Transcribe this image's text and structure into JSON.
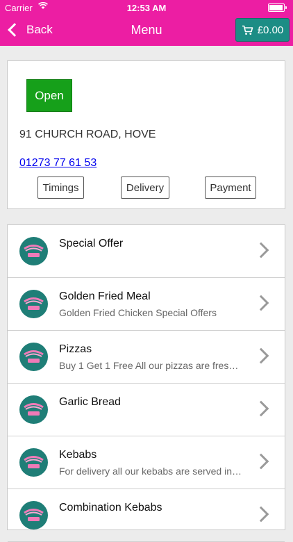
{
  "status_bar": {
    "carrier": "Carrier",
    "time": "12:53 AM"
  },
  "nav": {
    "back_label": "Back",
    "title": "Menu",
    "cart_total": "£0.00"
  },
  "colors": {
    "nav_background": "#ec1ea3",
    "cart_button": "#1c8d85",
    "open_button": "#16a01a",
    "logo_background": "#1f7e77"
  },
  "store": {
    "status": "Open",
    "address": "91 CHURCH ROAD, HOVE",
    "phone": "01273 77 61 53",
    "buttons": {
      "timings": "Timings",
      "delivery": "Delivery",
      "payment": "Payment"
    }
  },
  "menu": {
    "items": [
      {
        "name": "Special Offer",
        "description": ""
      },
      {
        "name": "Golden Fried Meal",
        "description": "Golden Fried Chicken Special Offers"
      },
      {
        "name": "Pizzas",
        "description": "Buy 1 Get 1 Free All our pizzas are fres…"
      },
      {
        "name": "Garlic Bread",
        "description": ""
      },
      {
        "name": "Kebabs",
        "description": "For delivery all our kebabs are served in…"
      },
      {
        "name": "Combination Kebabs",
        "description": ""
      }
    ]
  }
}
